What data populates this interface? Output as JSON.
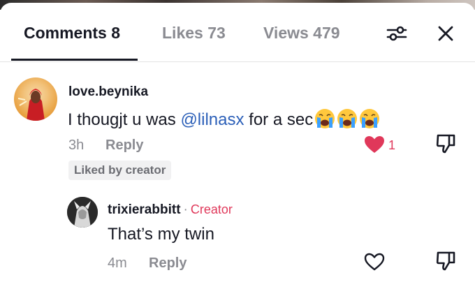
{
  "tabs": [
    {
      "label": "Comments",
      "count": "8"
    },
    {
      "label": "Likes",
      "count": "73"
    },
    {
      "label": "Views",
      "count": "479"
    }
  ],
  "tab_labels": {
    "comments": "Comments 8",
    "likes": "Likes 73",
    "views": "Views 479"
  },
  "icons": {
    "filter": "filter-sliders-icon",
    "close": "close-icon",
    "heart": "heart-icon",
    "dislike": "thumbs-down-icon",
    "emoji": "loudly-crying-face"
  },
  "colors": {
    "accent": "#e0385a",
    "mention": "#2b5fb8",
    "text": "#161823",
    "muted": "#8a8b91"
  },
  "comments": [
    {
      "username": "love.beynika",
      "text_before": "I thougjt u was ",
      "mention": "@lilnasx",
      "text_after": " for a sec",
      "emoji_count": 3,
      "time": "3h",
      "reply_label": "Reply",
      "likes": "1",
      "liked": true,
      "badge": "Liked by creator"
    },
    {
      "username": "trixierabbitt",
      "separator": "·",
      "creator_label": "Creator",
      "text": "That’s my twin",
      "time": "4m",
      "reply_label": "Reply",
      "liked": false
    }
  ]
}
